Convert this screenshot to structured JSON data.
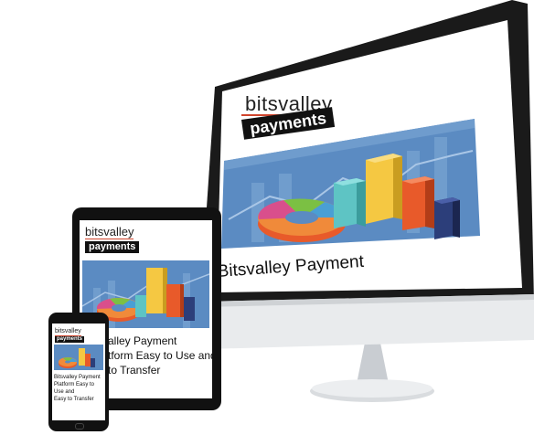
{
  "monitor": {
    "brand_top": "bitsvalley",
    "brand_bottom": "payments",
    "headline": "Bitsvalley Payment"
  },
  "tablet": {
    "brand_top": "bitsvalley",
    "brand_bottom": "payments",
    "headline_lines": [
      "alley Payment",
      "tform Easy to Use and",
      "to Transfer"
    ]
  },
  "phone": {
    "brand_top": "bitsvalley",
    "brand_bottom": "payments",
    "headline_lines": [
      "Bitsvalley Payment",
      "Platform Easy to Use and",
      "Easy to Transfer"
    ]
  },
  "colors": {
    "accent_red": "#d0442c",
    "chart_blue": "#4a7fb5",
    "bar_yellow": "#f5c842",
    "bar_orange": "#e85a2a",
    "bar_navy": "#2c3e7a"
  }
}
